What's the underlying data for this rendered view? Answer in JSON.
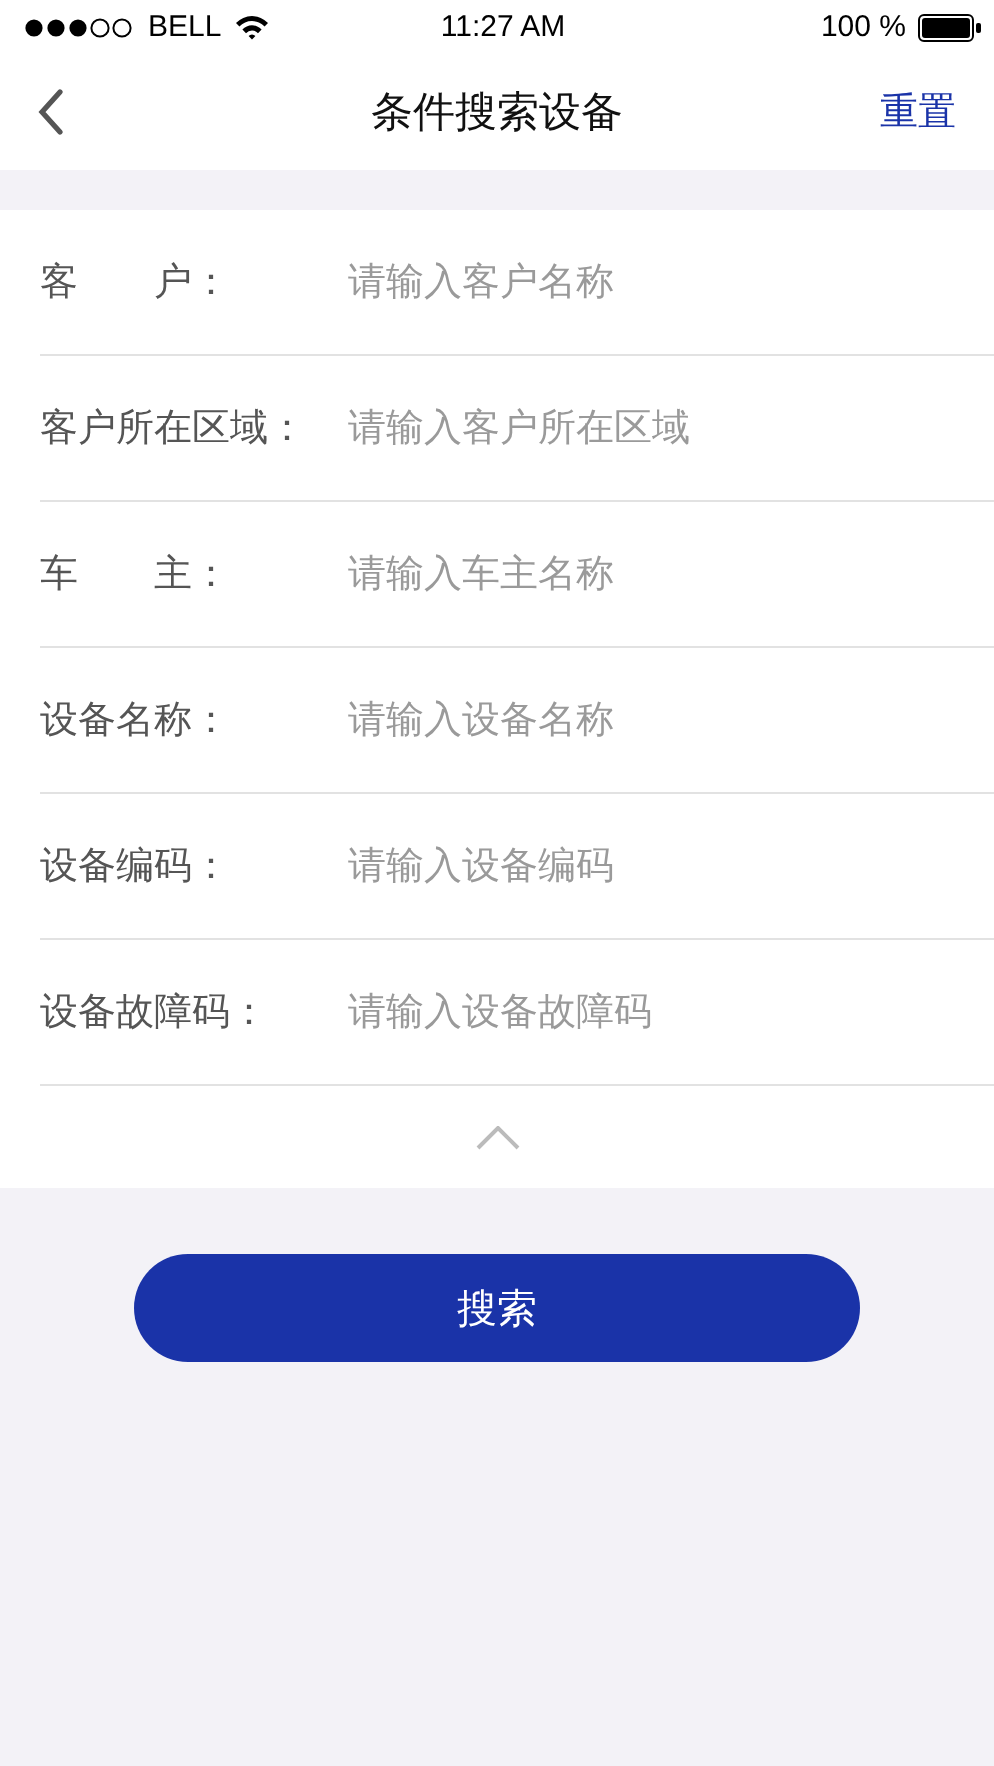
{
  "status_bar": {
    "carrier": "BELL",
    "time": "11:27 AM",
    "battery": "100 %"
  },
  "nav": {
    "title": "条件搜索设备",
    "action": "重置"
  },
  "fields": [
    {
      "label": "客　　户：",
      "placeholder": "请输入客户名称"
    },
    {
      "label": "客户所在区域：",
      "placeholder": "请输入客户所在区域"
    },
    {
      "label": "车　　主：",
      "placeholder": "请输入车主名称"
    },
    {
      "label": "设备名称：",
      "placeholder": "请输入设备名称"
    },
    {
      "label": "设备编码：",
      "placeholder": "请输入设备编码"
    },
    {
      "label": "设备故障码：",
      "placeholder": "请输入设备故障码"
    }
  ],
  "search_button": "搜索"
}
